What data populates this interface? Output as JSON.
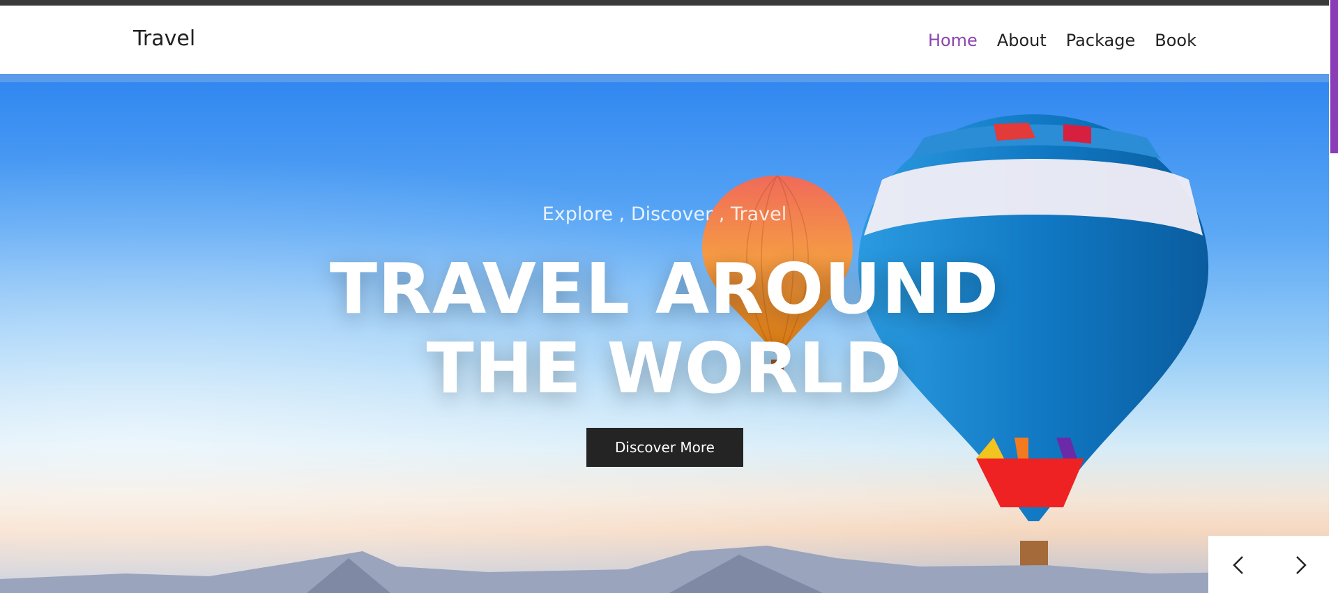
{
  "navbar": {
    "brand": "Travel",
    "links": [
      {
        "label": "Home",
        "active": true
      },
      {
        "label": "About",
        "active": false
      },
      {
        "label": "Package",
        "active": false
      },
      {
        "label": "Book",
        "active": false
      }
    ]
  },
  "hero": {
    "tagline": "Explore , Discover , Travel",
    "headline_line1": "TRAVEL AROUND",
    "headline_line2": "THE WORLD",
    "cta_label": "Discover More"
  },
  "carousel": {
    "prev_icon": "chevron-left-icon",
    "next_icon": "chevron-right-icon"
  },
  "colors": {
    "accent": "#8e44ad",
    "button_bg": "#242424",
    "topbar": "#3a3a3a"
  }
}
